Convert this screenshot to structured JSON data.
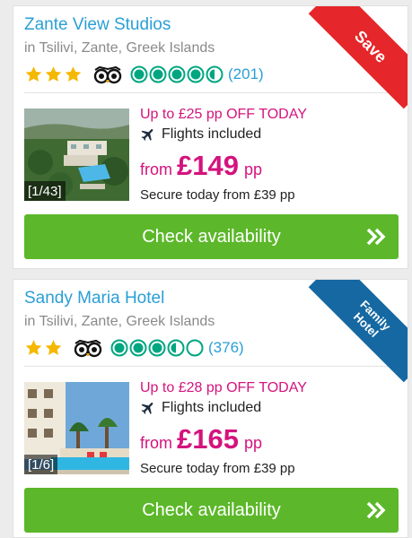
{
  "hotels": [
    {
      "name": "Zante View Studios",
      "location": "in Tsilivi, Zante, Greek Islands",
      "stars": 3,
      "ta_rating": 4.5,
      "review_count": "(201)",
      "image_counter": "[1/43]",
      "offer": "Up to £25 pp OFF TODAY",
      "flights": "Flights included",
      "price_prefix": "from",
      "price": "£149",
      "price_suffix": "pp",
      "deposit": "Secure today from £39 pp",
      "cta": "Check availability",
      "ribbon": {
        "line1": "Save",
        "line2": "",
        "color": "#e5262a"
      }
    },
    {
      "name": "Sandy Maria Hotel",
      "location": "in Tsilivi, Zante, Greek Islands",
      "stars": 2,
      "ta_rating": 3.5,
      "review_count": "(376)",
      "image_counter": "[1/6]",
      "offer": "Up to £28 pp OFF TODAY",
      "flights": "Flights included",
      "price_prefix": "from",
      "price": "£165",
      "price_suffix": "pp",
      "deposit": "Secure today from £39 pp",
      "cta": "Check availability",
      "ribbon": {
        "line1": "Family",
        "line2": "Hotel",
        "color": "#1568a1"
      }
    }
  ],
  "icons": {
    "star": "star-icon",
    "tripadvisor": "tripadvisor-owl-icon",
    "bubble": "rating-bubble-icon",
    "plane": "plane-icon",
    "chevron": "double-chevron-right-icon"
  },
  "colors": {
    "link": "#2a9fd6",
    "offer": "#d4137d",
    "cta": "#5cb82a",
    "star": "#f5b800",
    "bubble": "#00a680"
  }
}
